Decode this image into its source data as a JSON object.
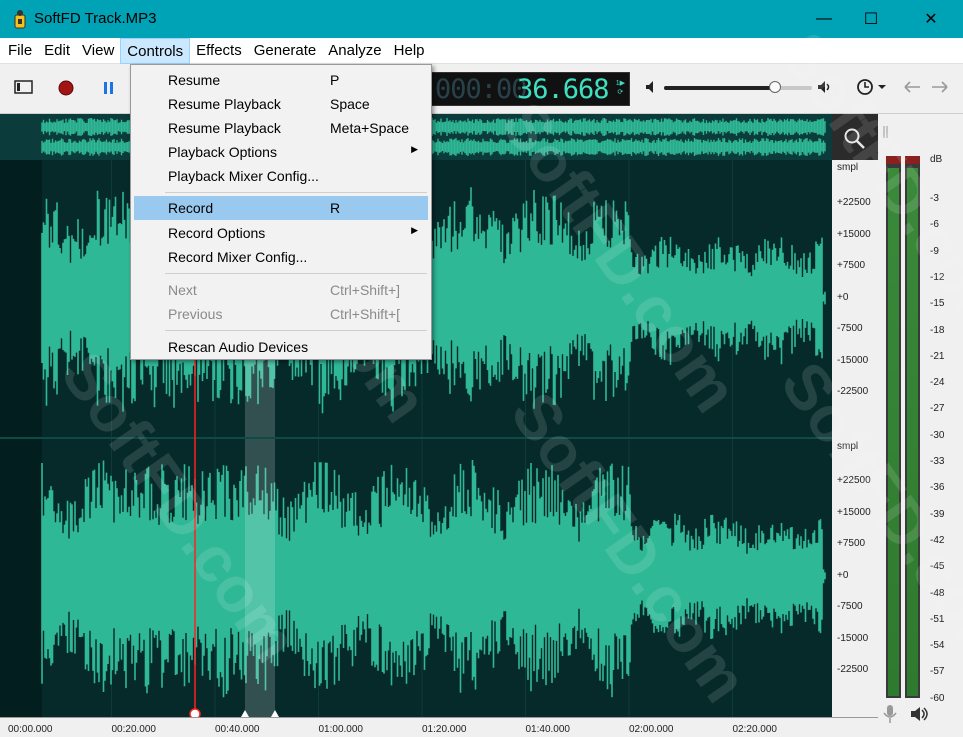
{
  "window": {
    "title": "SoftFD Track.MP3",
    "minimize_glyph": "—",
    "maximize_glyph": "☐",
    "close_glyph": "✕"
  },
  "menubar": {
    "items": [
      "File",
      "Edit",
      "View",
      "Controls",
      "Effects",
      "Generate",
      "Analyze",
      "Help"
    ],
    "active": "Controls"
  },
  "timecode": {
    "dim": "000:00",
    "value": "36.668",
    "sub_top": "1▶",
    "sub_bottom": "⟳"
  },
  "volume": {
    "level": 0.75
  },
  "controls_menu": {
    "items": [
      {
        "label": "Resume",
        "shortcut": "P"
      },
      {
        "label": "Resume Playback",
        "shortcut": "Space"
      },
      {
        "label": "Resume Playback",
        "shortcut": "Meta+Space"
      },
      {
        "label": "Playback Options",
        "shortcut": "",
        "submenu": true
      },
      {
        "label": "Playback Mixer Config...",
        "shortcut": ""
      },
      {
        "label": "Record",
        "shortcut": "R",
        "highlighted": true
      },
      {
        "label": "Record Options",
        "shortcut": "",
        "submenu": true
      },
      {
        "label": "Record Mixer Config...",
        "shortcut": ""
      },
      {
        "label": "Next",
        "shortcut": "Ctrl+Shift+]",
        "disabled": true
      },
      {
        "label": "Previous",
        "shortcut": "Ctrl+Shift+[",
        "disabled": true
      },
      {
        "label": "Rescan Audio Devices",
        "shortcut": ""
      }
    ]
  },
  "amplitude_ruler": {
    "unit": "smpl",
    "ticks_top": [
      "+22500",
      "+15000",
      "+7500",
      "+0",
      "-7500",
      "-15000",
      "-22500"
    ],
    "ticks_bottom": [
      "+22500",
      "+15000",
      "+7500",
      "+0",
      "-7500",
      "-15000",
      "-22500"
    ]
  },
  "meter": {
    "unit": "dB",
    "ticks": [
      "-3",
      "-6",
      "-9",
      "-12",
      "-15",
      "-18",
      "-21",
      "-24",
      "-27",
      "-30",
      "-33",
      "-36",
      "-39",
      "-42",
      "-45",
      "-48",
      "-51",
      "-54",
      "-57",
      "-60"
    ]
  },
  "time_ruler": {
    "ticks": [
      "00:00.000",
      "00:20.000",
      "00:40.000",
      "01:00.000",
      "01:20.000",
      "01:40.000",
      "02:00.000",
      "02:20.000"
    ]
  },
  "watermark": "SoftFD.com",
  "colors": {
    "title_bar": "#00a2b6",
    "waveform": "#2fb896",
    "background": "#062a2a",
    "cursor": "#ff2020",
    "menu_highlight": "#99c9ef"
  }
}
